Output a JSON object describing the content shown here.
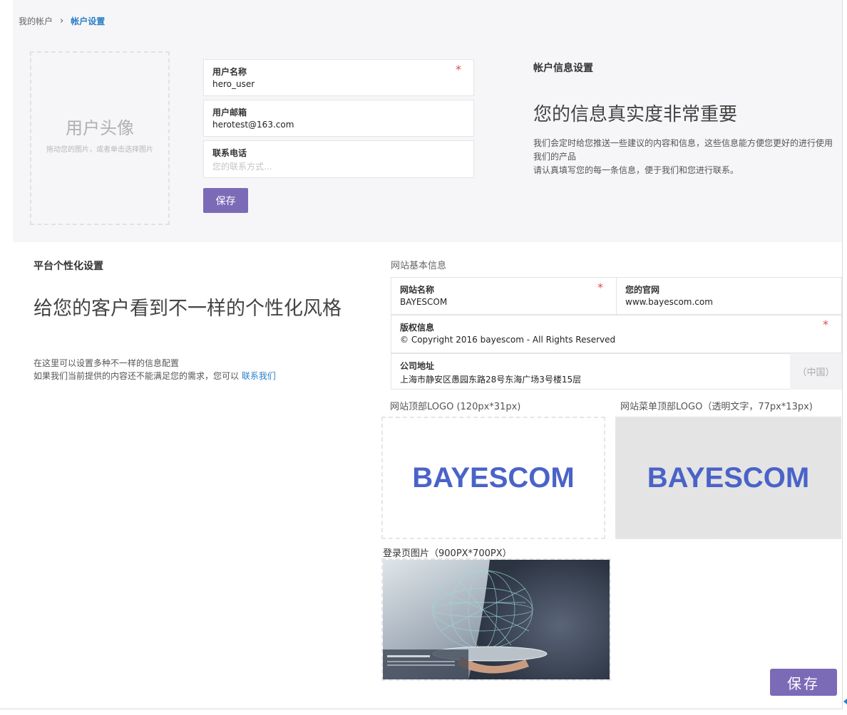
{
  "breadcrumb": {
    "root": "我的帐户",
    "separator": "›",
    "current": "帐户设置"
  },
  "avatar": {
    "title": "用户头像",
    "hint": "拖动您的图片，或者单击选择图片"
  },
  "account_form": {
    "username": {
      "label": "用户名称",
      "value": "hero_user",
      "required_mark": "*"
    },
    "email": {
      "label": "用户邮箱",
      "value": "herotest@163.com"
    },
    "phone": {
      "label": "联系电话",
      "placeholder": "您的联系方式..."
    },
    "save_label": "保存"
  },
  "account_info": {
    "title": "帐户信息设置",
    "headline": "您的信息真实度非常重要",
    "desc_line1": "我们会定时给您推送一些建议的内容和信息，这些信息能方便您更好的进行使用我们的产品",
    "desc_line2": "请认真填写您的每一条信息，便于我们和您进行联系。"
  },
  "platform": {
    "title": "平台个性化设置",
    "headline": "给您的客户看到不一样的个性化风格",
    "desc_line1": "在这里可以设置多种不一样的信息配置",
    "desc_line2": "如果我们当前提供的内容还不能满足您的需求，您可以",
    "contact_link": "联系我们"
  },
  "site_info": {
    "title": "网站基本信息",
    "site_name": {
      "label": "网站名称",
      "value": "BAYESCOM",
      "required_mark": "*"
    },
    "website": {
      "label": "您的官网",
      "value": "www.bayescom.com"
    },
    "copyright": {
      "label": "版权信息",
      "value": "© Copyright 2016 bayescom - All Rights Reserved",
      "required_mark": "*"
    },
    "address": {
      "label": "公司地址",
      "value": "上海市静安区愚园东路28号东海广场3号楼15层",
      "country": "（中国）"
    }
  },
  "logos": {
    "top_logo_label": "网站顶部LOGO (120px*31px)",
    "menu_logo_label": "网站菜单顶部LOGO（透明文字，77px*13px)",
    "logo_text": "BAYESCOM",
    "brand_color": "#4a63c8"
  },
  "login_image": {
    "label": "登录页图片（900PX*700PX）"
  },
  "footer": {
    "save_label": "保存"
  },
  "colors": {
    "accent": "#7b6bb7",
    "link": "#2a7ec8",
    "required": "#e04b4b"
  }
}
